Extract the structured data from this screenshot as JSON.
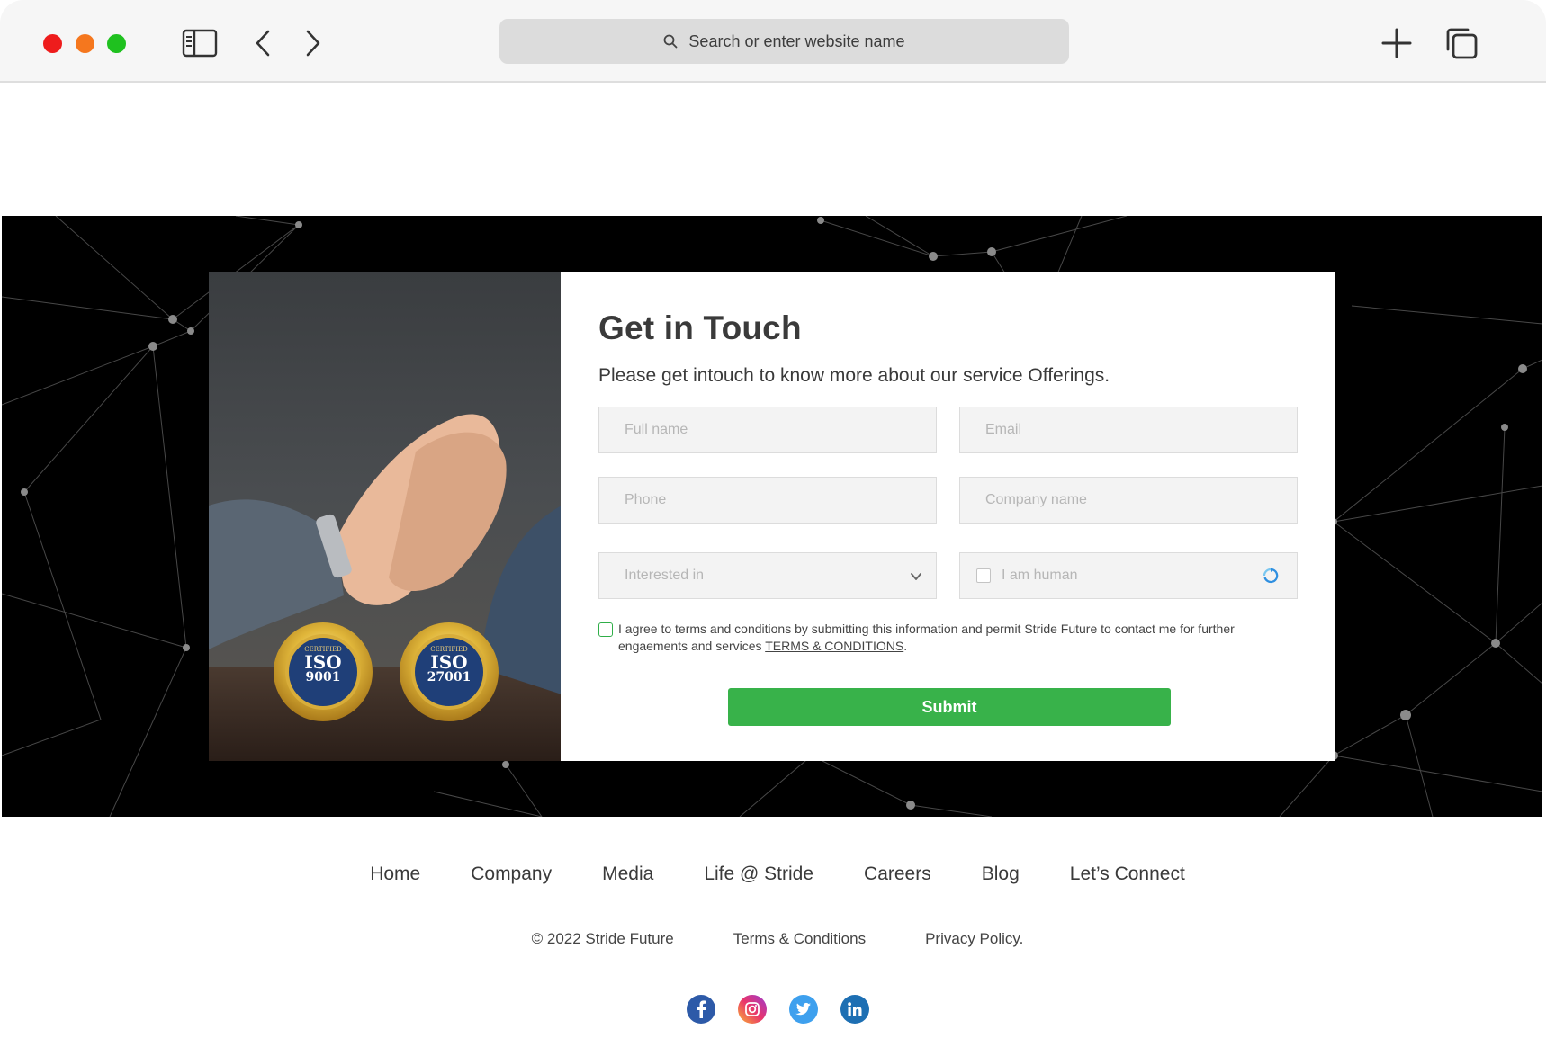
{
  "browser": {
    "url_placeholder": "Search or enter website name"
  },
  "contact": {
    "title": "Get in Touch",
    "subtitle": "Please get intouch to know more about our service Offerings.",
    "fields": {
      "full_name": "Full name",
      "email": "Email",
      "phone": "Phone",
      "company": "Company name",
      "interested_in": "Interested in",
      "captcha": "I am human"
    },
    "consent_text": "I agree to terms and conditions by submitting this information and permit Stride Future to contact me for further engaements and services",
    "consent_link": "TERMS & CONDITIONS",
    "consent_tail": ".",
    "submit_label": "Submit",
    "badges": [
      {
        "top": "CERTIFIED",
        "name": "ISO",
        "number": "9001"
      },
      {
        "top": "CERTIFIED",
        "name": "ISO",
        "number": "27001"
      }
    ]
  },
  "footer": {
    "nav": [
      "Home",
      "Company",
      "Media",
      "Life @ Stride",
      "Careers",
      "Blog",
      "Let’s Connect"
    ],
    "copyright": "© 2022 Stride Future",
    "terms": "Terms & Conditions",
    "privacy": "Privacy Policy.",
    "social": [
      "facebook-icon",
      "instagram-icon",
      "twitter-icon",
      "linkedin-icon"
    ]
  },
  "colors": {
    "accent": "#38b24a",
    "hero_bg": "#000000"
  }
}
